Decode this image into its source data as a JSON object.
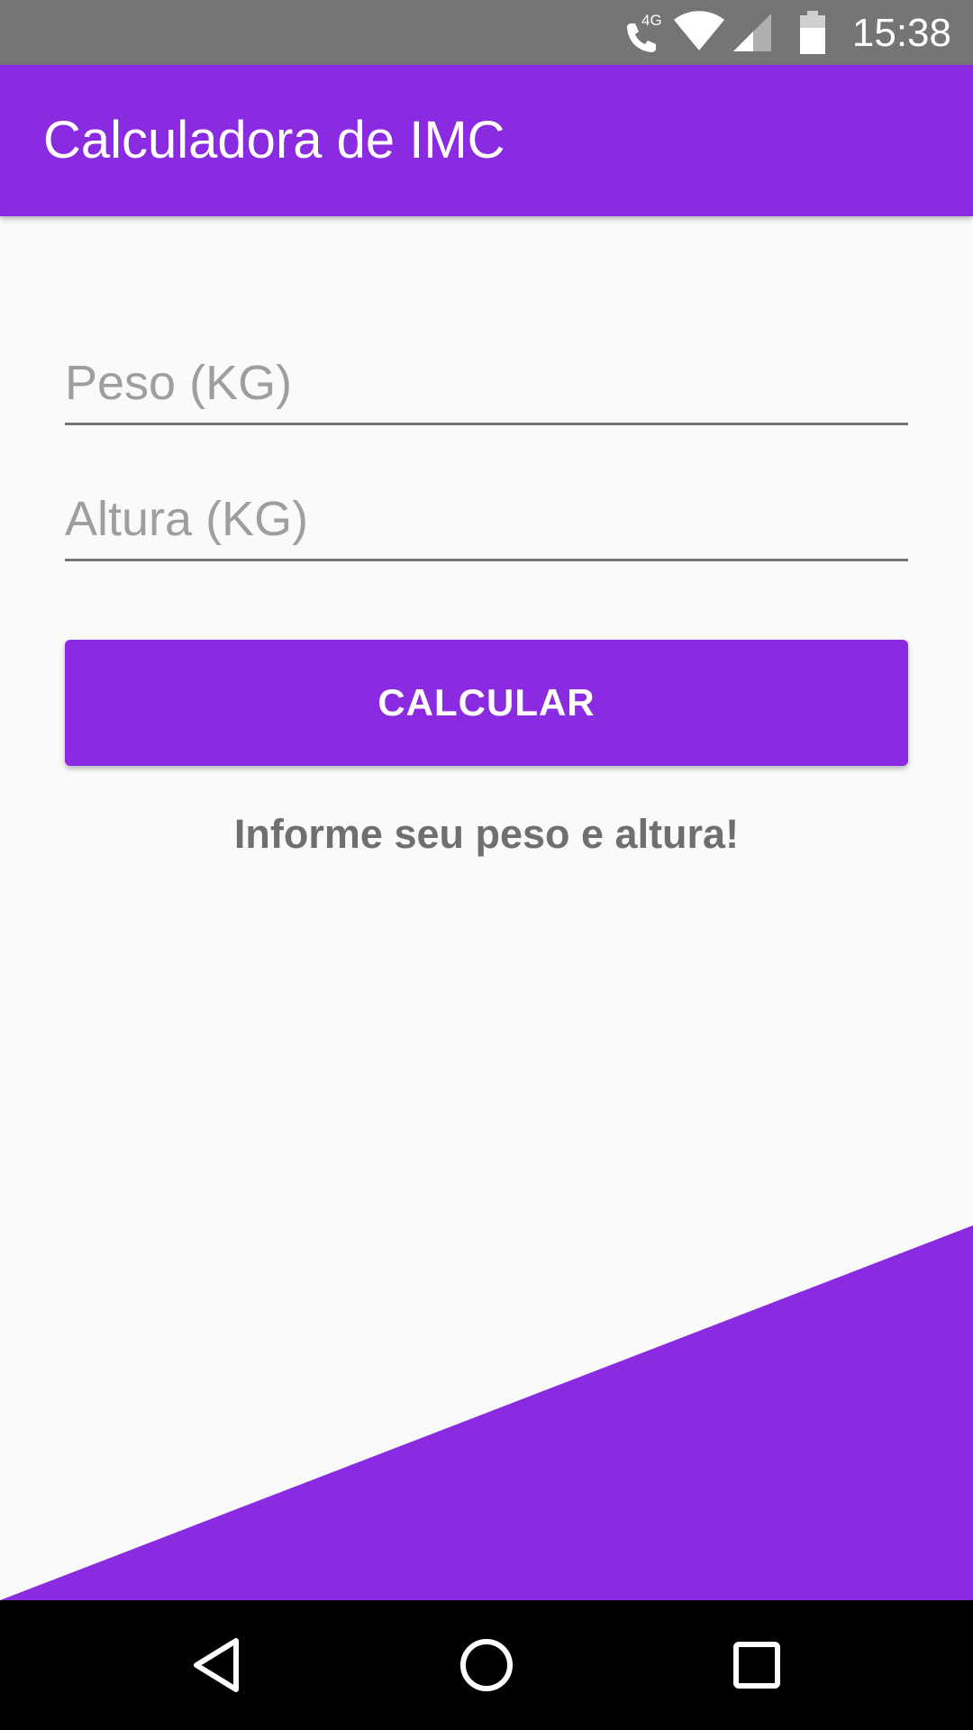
{
  "status_bar": {
    "time": "15:38",
    "network_label": "4G",
    "icons": [
      "call-4g-icon",
      "wifi-icon",
      "signal-icon",
      "battery-icon"
    ]
  },
  "app_bar": {
    "title": "Calculadora de IMC"
  },
  "form": {
    "peso": {
      "value": "",
      "placeholder": "Peso (KG)"
    },
    "altura": {
      "value": "",
      "placeholder": "Altura (KG)"
    },
    "calculate_label": "CALCULAR"
  },
  "result": {
    "message": "Informe seu peso e altura!"
  },
  "nav_bar": {
    "icons": [
      "back-icon",
      "home-icon",
      "recents-icon"
    ]
  },
  "colors": {
    "accent": "#8a2be2",
    "status_bar": "#757575",
    "background": "#fafafa",
    "nav_bar": "#000000",
    "result_text": "#6f6f6f"
  }
}
